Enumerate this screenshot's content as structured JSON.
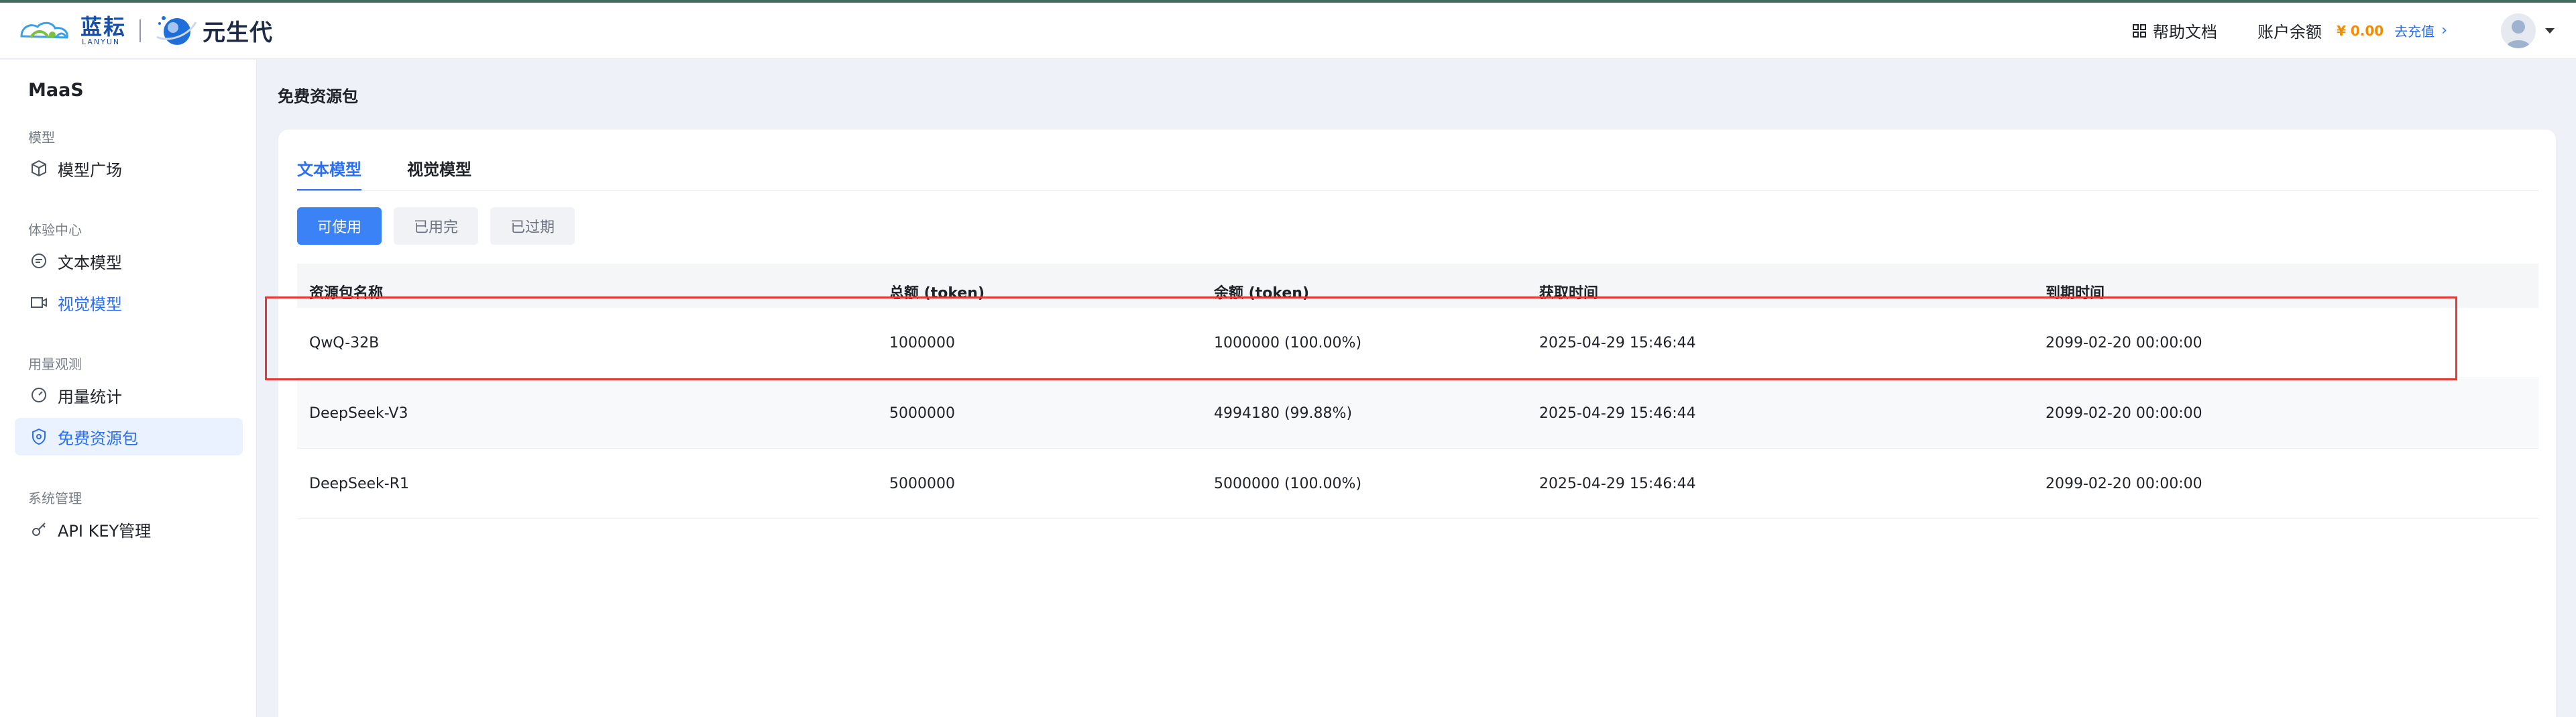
{
  "header": {
    "logo_cn": "蓝耘",
    "logo_en": "LANYUN",
    "logo2_text": "元生代",
    "help_label": "帮助文档",
    "balance_label": "账户余额",
    "balance_amount": "¥ 0.00",
    "recharge_label": "去充值"
  },
  "sidebar": {
    "brand": "MaaS",
    "groups": [
      {
        "title": "模型",
        "items": [
          {
            "label": "模型广场",
            "icon": "cube-icon"
          }
        ]
      },
      {
        "title": "体验中心",
        "items": [
          {
            "label": "文本模型",
            "icon": "chat-icon"
          },
          {
            "label": "视觉模型",
            "icon": "video-icon"
          }
        ]
      },
      {
        "title": "用量观测",
        "items": [
          {
            "label": "用量统计",
            "icon": "gauge-icon"
          },
          {
            "label": "免费资源包",
            "icon": "shield-icon"
          }
        ]
      },
      {
        "title": "系统管理",
        "items": [
          {
            "label": "API KEY管理",
            "icon": "key-icon"
          }
        ]
      }
    ]
  },
  "main": {
    "page_title": "免费资源包",
    "tabs": [
      {
        "label": "文本模型"
      },
      {
        "label": "视觉模型"
      }
    ],
    "filters": [
      {
        "label": "可使用"
      },
      {
        "label": "已用完"
      },
      {
        "label": "已过期"
      }
    ],
    "table": {
      "columns": [
        "资源包名称",
        "总额 (token)",
        "余额 (token)",
        "获取时间",
        "到期时间"
      ],
      "rows": [
        [
          "QwQ-32B",
          "1000000",
          "1000000 (100.00%)",
          "2025-04-29 15:46:44",
          "2099-02-20 00:00:00"
        ],
        [
          "DeepSeek-V3",
          "5000000",
          "4994180 (99.88%)",
          "2025-04-29 15:46:44",
          "2099-02-20 00:00:00"
        ],
        [
          "DeepSeek-R1",
          "5000000",
          "5000000 (100.00%)",
          "2025-04-29 15:46:44",
          "2099-02-20 00:00:00"
        ]
      ]
    }
  },
  "colors": {
    "accent": "#2c6ef2",
    "primary_button": "#3b82f6",
    "balance": "#f28b00",
    "highlight_box": "#e53935"
  }
}
